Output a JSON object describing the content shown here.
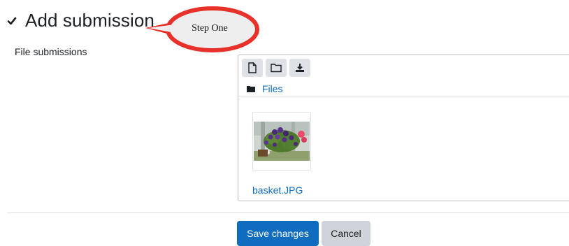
{
  "section": {
    "title": "Add submission"
  },
  "annotation": {
    "text": "Step One",
    "stroke_color": "#e8312a",
    "fill_color": "#eeeeee"
  },
  "field": {
    "label": "File submissions"
  },
  "filemanager": {
    "toolbar": [
      {
        "name": "add-file",
        "icon": "file-icon"
      },
      {
        "name": "create-folder",
        "icon": "folder-icon"
      },
      {
        "name": "download",
        "icon": "download-icon"
      }
    ],
    "path": "Files",
    "files": [
      {
        "name": "basket.JPG"
      }
    ]
  },
  "actions": {
    "save_label": "Save changes",
    "cancel_label": "Cancel"
  },
  "colors": {
    "primary": "#0f6cbf",
    "link": "#0f6cbf",
    "secondary_bg": "#ced4da"
  }
}
